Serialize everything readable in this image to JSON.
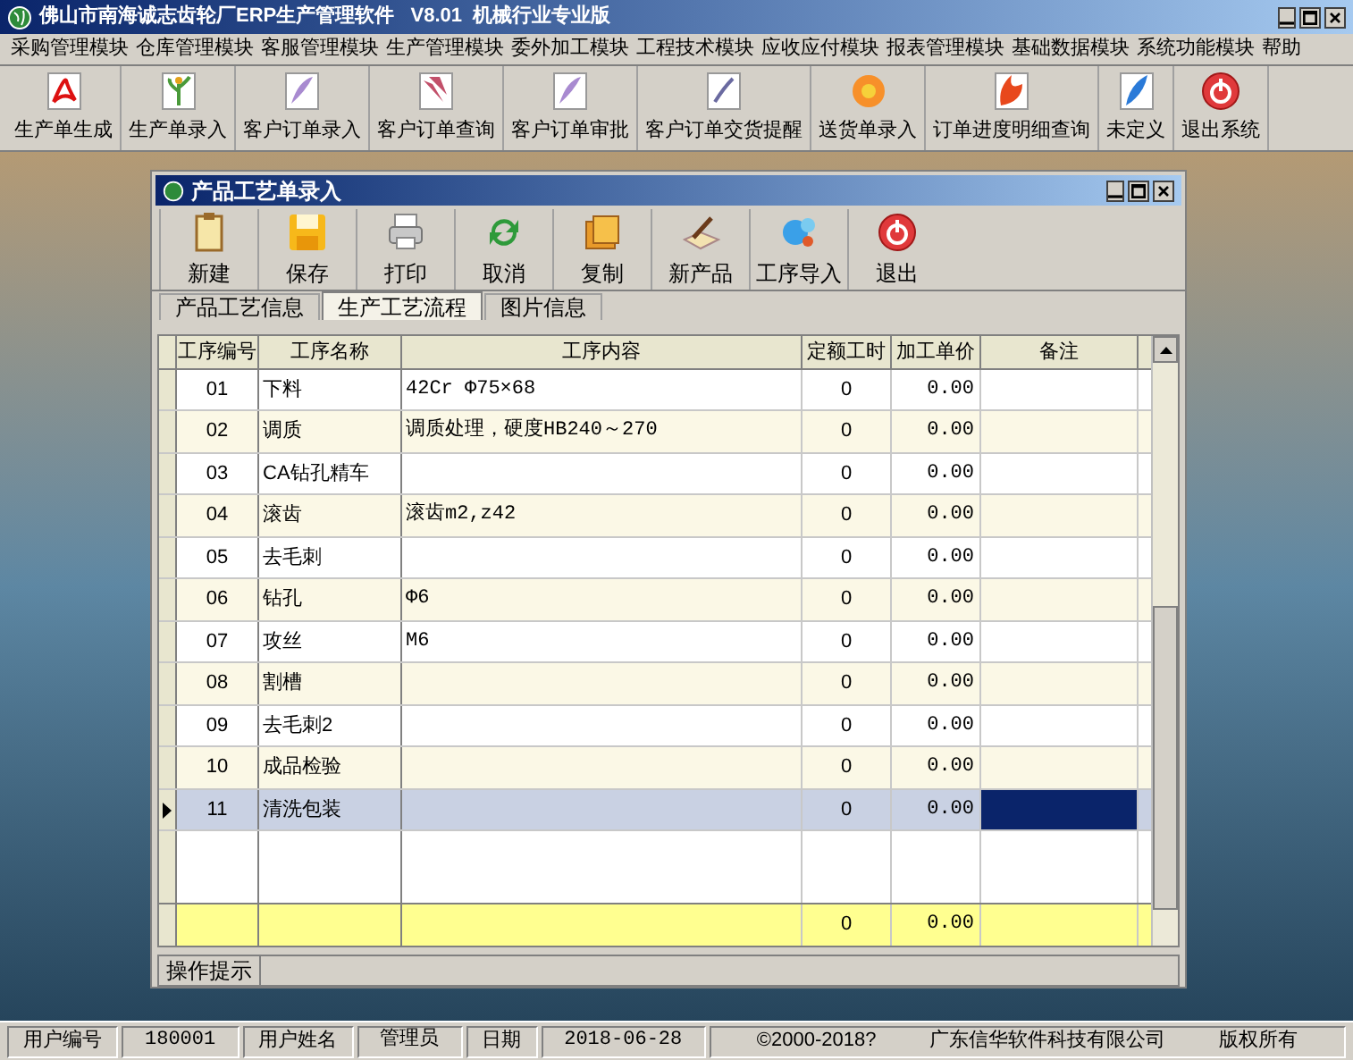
{
  "window": {
    "title": "佛山市南海诚志齿轮厂ERP生产管理软件   V8.01  机械行业专业版"
  },
  "menu": [
    "采购管理模块",
    "仓库管理模块",
    "客服管理模块",
    "生产管理模块",
    "委外加工模块",
    "工程技术模块",
    "应收应付模块",
    "报表管理模块",
    "基础数据模块",
    "系统功能模块",
    "帮助"
  ],
  "toolbar": [
    {
      "label": "生产单生成",
      "kind": "pdf"
    },
    {
      "label": "生产单录入",
      "kind": "plant"
    },
    {
      "label": "客户订单录入",
      "kind": "feather"
    },
    {
      "label": "客户订单查询",
      "kind": "lily"
    },
    {
      "label": "客户订单审批",
      "kind": "feather"
    },
    {
      "label": "客户订单交货提醒",
      "kind": "doc"
    },
    {
      "label": "送货单录入",
      "kind": "flower"
    },
    {
      "label": "订单进度明细查询",
      "kind": "fire"
    },
    {
      "label": "未定义",
      "kind": "quill"
    },
    {
      "label": "退出系统",
      "kind": "exit"
    }
  ],
  "dialog": {
    "title": "产品工艺单录入",
    "toolbar": [
      {
        "label": "新建",
        "kind": "clipboard"
      },
      {
        "label": "保存",
        "kind": "disk"
      },
      {
        "label": "打印",
        "kind": "printer"
      },
      {
        "label": "取消",
        "kind": "refresh"
      },
      {
        "label": "复制",
        "kind": "copy"
      },
      {
        "label": "新产品",
        "kind": "pen"
      },
      {
        "label": "工序导入",
        "kind": "import"
      },
      {
        "label": "退出",
        "kind": "exit"
      }
    ],
    "tabs": [
      {
        "label": "产品工艺信息",
        "selected": false
      },
      {
        "label": "生产工艺流程",
        "selected": true
      },
      {
        "label": "图片信息",
        "selected": false
      }
    ],
    "table": {
      "columns": [
        "工序编号",
        "工序名称",
        "工序内容",
        "定额工时",
        "加工单价",
        "备注"
      ],
      "rows": [
        {
          "no": "01",
          "name": "下料",
          "content": "42Cr  Φ75×68",
          "hours": "0",
          "price": "0.00",
          "selected": false
        },
        {
          "no": "02",
          "name": "调质",
          "content": "调质处理，硬度HB240～270",
          "hours": "0",
          "price": "0.00",
          "selected": false
        },
        {
          "no": "03",
          "name": "CA钻孔精车",
          "content": "",
          "hours": "0",
          "price": "0.00",
          "selected": false
        },
        {
          "no": "04",
          "name": "滚齿",
          "content": "滚齿m2,z42",
          "hours": "0",
          "price": "0.00",
          "selected": false
        },
        {
          "no": "05",
          "name": "去毛刺",
          "content": "",
          "hours": "0",
          "price": "0.00",
          "selected": false
        },
        {
          "no": "06",
          "name": "钻孔",
          "content": "Φ6",
          "hours": "0",
          "price": "0.00",
          "selected": false
        },
        {
          "no": "07",
          "name": "攻丝",
          "content": "M6",
          "hours": "0",
          "price": "0.00",
          "selected": false
        },
        {
          "no": "08",
          "name": "割槽",
          "content": "",
          "hours": "0",
          "price": "0.00",
          "selected": false
        },
        {
          "no": "09",
          "name": "去毛刺2",
          "content": "",
          "hours": "0",
          "price": "0.00",
          "selected": false
        },
        {
          "no": "10",
          "name": "成品检验",
          "content": "",
          "hours": "0",
          "price": "0.00",
          "selected": false
        },
        {
          "no": "11",
          "name": "清洗包装",
          "content": "",
          "hours": "0",
          "price": "0.00",
          "selected": true
        }
      ],
      "totals": {
        "hours": "0",
        "price": "0.00"
      }
    },
    "hint_label": "操作提示"
  },
  "status_bar": [
    {
      "text": "用户编号",
      "kind": "label"
    },
    {
      "text": "180001",
      "kind": "value"
    },
    {
      "text": "用户姓名",
      "kind": "label"
    },
    {
      "text": "管理员",
      "kind": "value"
    },
    {
      "text": "日期",
      "kind": "label"
    },
    {
      "text": "2018-06-28",
      "kind": "value"
    },
    {
      "text": "©2000-2018?",
      "kind": "info"
    },
    {
      "text": "广东信华软件科技有限公司",
      "kind": "info"
    },
    {
      "text": "版权所有",
      "kind": "info"
    }
  ]
}
